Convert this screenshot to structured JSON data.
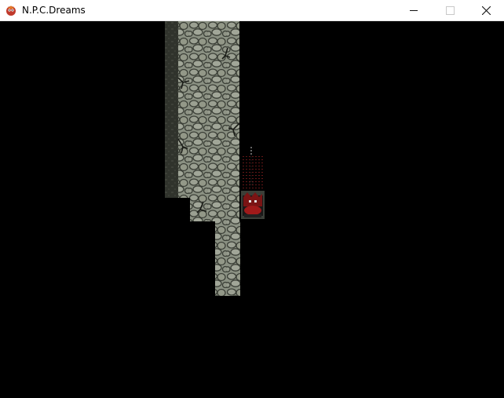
{
  "window": {
    "title": "N.P.C.Dreams",
    "app_icon": "npc-dreams-icon",
    "controls": [
      {
        "name": "minimize",
        "icon": "minimize-icon",
        "enabled": true
      },
      {
        "name": "maximize",
        "icon": "maximize-icon",
        "enabled": false
      },
      {
        "name": "close",
        "icon": "close-icon",
        "enabled": true
      }
    ]
  },
  "scene": {
    "background": "#000000",
    "floor_color": "#8c9283",
    "stone_shadow": "#2e322b",
    "wall_color": "#3a3d35",
    "character": {
      "name": "player-character",
      "accent": "#a01a1a"
    }
  }
}
